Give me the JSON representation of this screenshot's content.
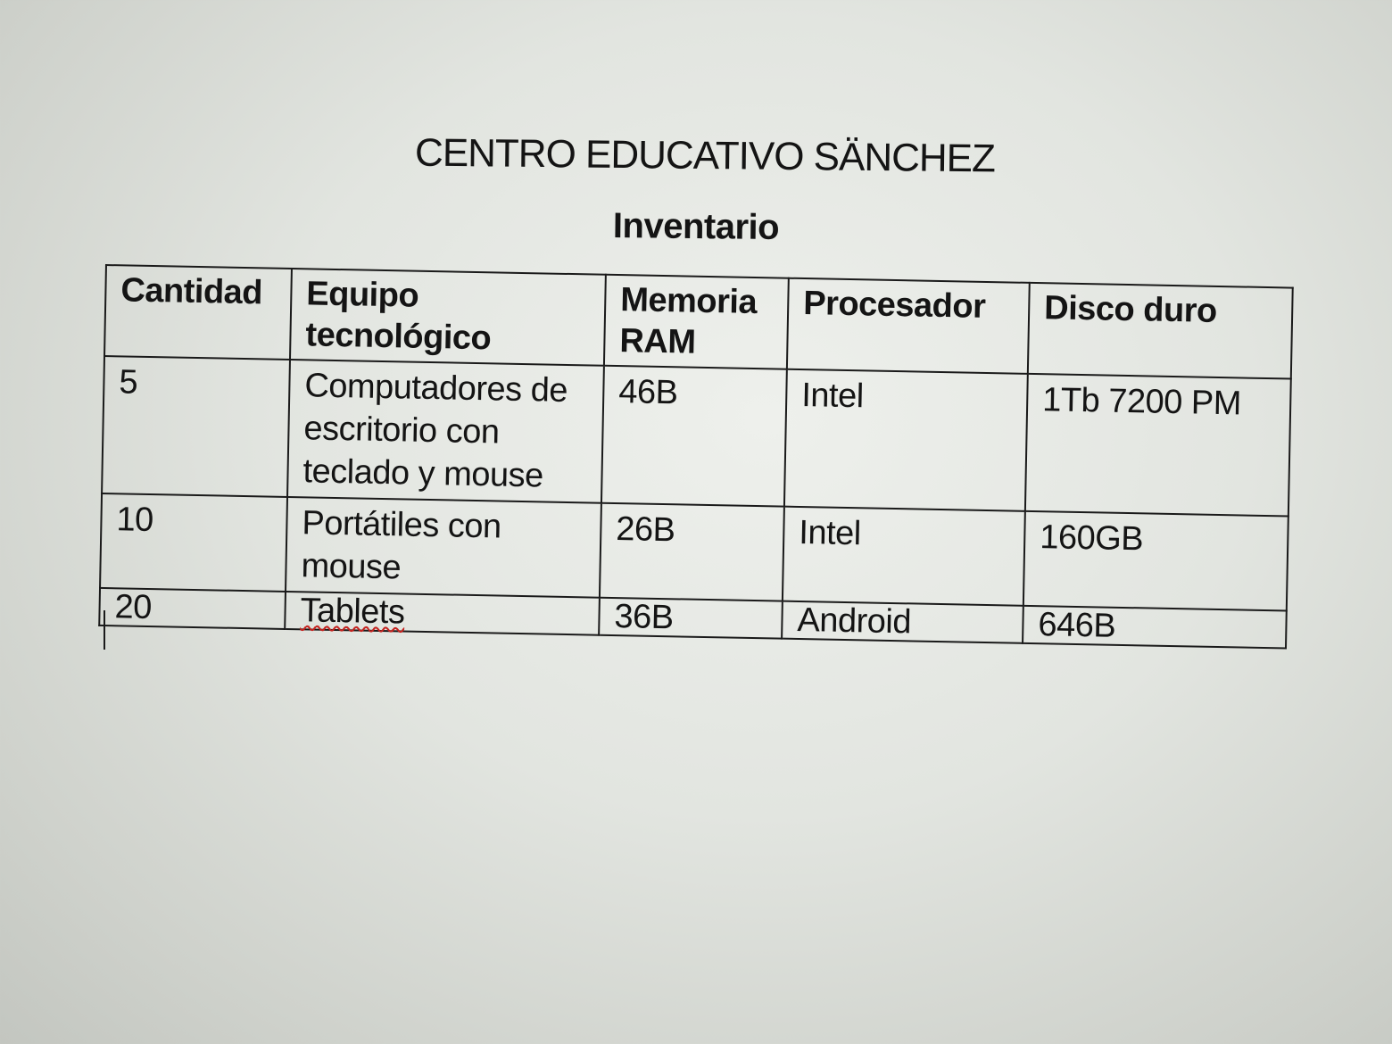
{
  "document": {
    "title": "CENTRO EDUCATIVO SÄNCHEZ",
    "subtitle": "Inventario"
  },
  "table": {
    "headers": [
      "Cantidad",
      "Equipo tecnológico",
      "Memoria RAM",
      "Procesador",
      "Disco duro"
    ],
    "rows": [
      [
        "5",
        "Computadores de escritorio con teclado y mouse",
        "46B",
        "Intel",
        "1Tb 7200 PM"
      ],
      [
        "10",
        "Portátiles con mouse",
        "26B",
        "Intel",
        "160GB"
      ],
      [
        "20",
        "Tablets",
        "36B",
        "Android",
        "646B"
      ]
    ]
  }
}
